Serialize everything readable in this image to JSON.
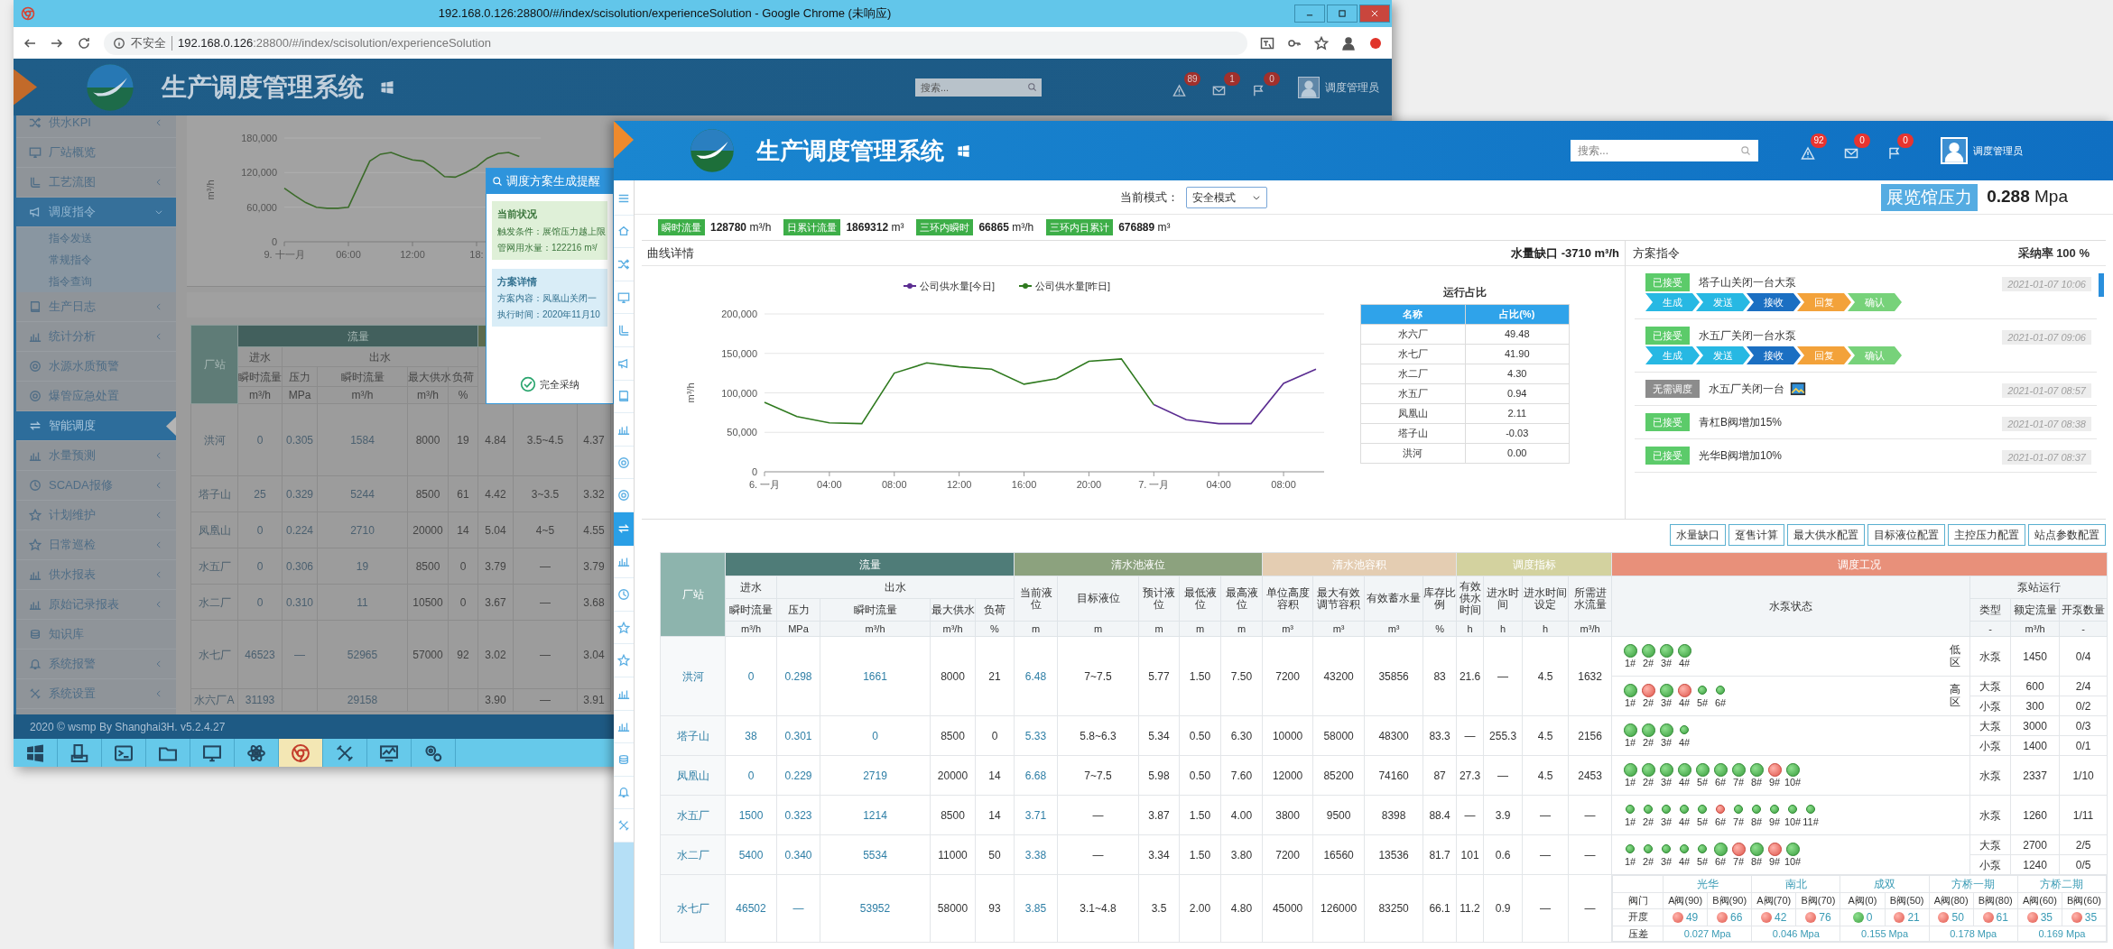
{
  "back_window": {
    "title": "192.168.0.126:28800/#/index/scisolution/experienceSolution - Google Chrome (未响应)",
    "security": "不安全",
    "url_host": "192.168.0.126",
    "url_path": ":28800/#/index/scisolution/experienceSolution",
    "app_title": "生产调度管理系统",
    "search": {
      "placeholder": "搜索..."
    },
    "notifications": [
      {
        "kind": "alert",
        "count": "89"
      },
      {
        "kind": "mail",
        "count": "1"
      },
      {
        "kind": "flag",
        "count": "0"
      }
    ],
    "user": "调度管理员",
    "sidebar": [
      {
        "kind": "shuffle",
        "label": "供水KPI",
        "selected": false,
        "expanded": false
      },
      {
        "kind": "monitor",
        "label": "厂站概览",
        "selected": false
      },
      {
        "kind": "pipe",
        "label": "工艺流图",
        "selected": false,
        "expanded": false
      },
      {
        "kind": "megaphone",
        "label": "调度指令",
        "selected": false,
        "expanded": true,
        "children": [
          {
            "label": "指令发送"
          },
          {
            "label": "常规指令"
          },
          {
            "label": "指令查询"
          }
        ]
      },
      {
        "kind": "book",
        "label": "生产日志",
        "selected": false,
        "expanded": false
      },
      {
        "kind": "chart",
        "label": "统计分析",
        "selected": false,
        "expanded": false
      },
      {
        "kind": "target",
        "label": "水源水质预警",
        "selected": false
      },
      {
        "kind": "target",
        "label": "爆管应急处置",
        "selected": false
      },
      {
        "kind": "swap",
        "label": "智能调度",
        "selected": true
      },
      {
        "kind": "chart",
        "label": "水量预测",
        "selected": false,
        "expanded": false
      },
      {
        "kind": "clock",
        "label": "SCADA报修",
        "selected": false,
        "expanded": false
      },
      {
        "kind": "star",
        "label": "计划维护",
        "selected": false,
        "expanded": false
      },
      {
        "kind": "star",
        "label": "日常巡检",
        "selected": false,
        "expanded": false
      },
      {
        "kind": "chart",
        "label": "供水报表",
        "selected": false,
        "expanded": false
      },
      {
        "kind": "chart",
        "label": "原始记录报表",
        "selected": false,
        "expanded": false
      },
      {
        "kind": "coins",
        "label": "知识库",
        "selected": false
      },
      {
        "kind": "bell",
        "label": "系统报警",
        "selected": false,
        "expanded": false
      },
      {
        "kind": "tools",
        "label": "系统设置",
        "selected": false,
        "expanded": false
      }
    ],
    "chart": {
      "chart_data": {
        "type": "line",
        "ylabel": "m³/h",
        "grid": true,
        "x": [
          "2020-11-09T00:00",
          "2020-11-09T01:00",
          "2020-11-09T02:00",
          "2020-11-09T03:00",
          "2020-11-09T04:00",
          "2020-11-09T05:00",
          "2020-11-09T06:00",
          "2020-11-09T07:00",
          "2020-11-09T08:00",
          "2020-11-09T09:00",
          "2020-11-09T10:00",
          "2020-11-09T11:00",
          "2020-11-09T12:00",
          "2020-11-09T13:00",
          "2020-11-09T14:00",
          "2020-11-09T15:00",
          "2020-11-09T16:00",
          "2020-11-09T17:00",
          "2020-11-09T18:00",
          "2020-11-09T19:00",
          "2020-11-09T20:00",
          "2020-11-09T21:00",
          "2020-11-09T22:00"
        ],
        "xlim": [
          "2020-11-09T00:00",
          "2020-11-10T00:00"
        ],
        "ylim": [
          0,
          180000
        ],
        "xticks": [
          {
            "value": "2020-11-09T00:00",
            "label": "9. 十一月"
          },
          {
            "value": "2020-11-09T06:00",
            "label": "06:00"
          },
          {
            "value": "2020-11-09T12:00",
            "label": "12:00"
          },
          {
            "value": "2020-11-09T18:00",
            "label": "18:"
          }
        ],
        "yticks": [
          {
            "value": 0,
            "label": "0"
          },
          {
            "value": 60000,
            "label": "60,000"
          },
          {
            "value": 120000,
            "label": "120,000"
          },
          {
            "value": 180000,
            "label": "180,000"
          }
        ],
        "series": [
          {
            "color": "#3b6b2a",
            "values": [
              93000,
              80000,
              68000,
              60000,
              58000,
              58000,
              60000,
              100000,
              140000,
              152000,
              155000,
              148000,
              142000,
              140000,
              128000,
              113000,
              112000,
              120000,
              130000,
              145000,
              153000,
              155000,
              148000
            ]
          }
        ]
      }
    },
    "table": {
      "station_header": "厂站",
      "group": "流量",
      "inflow": "进水",
      "outflow": "出水",
      "columns": [
        {
          "label": "瞬时流量",
          "unit": "m³/h"
        },
        {
          "label": "压力",
          "unit": "MPa"
        },
        {
          "label": "瞬时流量",
          "unit": "m³/h"
        },
        {
          "label": "最大供水",
          "unit": "m³/h"
        },
        {
          "label": "负荷",
          "unit": "%"
        }
      ],
      "rows": [
        {
          "station": "洪河",
          "cells": [
            "0",
            "0.305",
            "1584",
            "8000",
            "19",
            "4.84",
            "3.5~4.5",
            "4.37"
          ]
        },
        {
          "station": "塔子山",
          "cells": [
            "25",
            "0.329",
            "5244",
            "8500",
            "61",
            "4.42",
            "3~3.5",
            "3.32"
          ]
        },
        {
          "station": "凤凰山",
          "cells": [
            "0",
            "0.224",
            "2710",
            "20000",
            "14",
            "5.04",
            "4~5",
            "4.55"
          ]
        },
        {
          "station": "水五厂",
          "cells": [
            "0",
            "0.306",
            "19",
            "8500",
            "0",
            "3.79",
            "—",
            "3.79"
          ]
        },
        {
          "station": "水二厂",
          "cells": [
            "0",
            "0.310",
            "11",
            "10500",
            "0",
            "3.67",
            "—",
            "3.68"
          ]
        },
        {
          "station": "水七厂",
          "cells": [
            "46523",
            "—",
            "52965",
            "57000",
            "92",
            "3.02",
            "—",
            "3.04"
          ]
        },
        {
          "station": "水六厂A",
          "cells": [
            "31193",
            null,
            "29158",
            null,
            null,
            "3.90",
            "—",
            "3.91"
          ]
        }
      ]
    },
    "popup": {
      "title": "调度方案生成提醒",
      "sections": [
        {
          "kind": "status",
          "heading": "当前状况",
          "lines": [
            "触发条件：展馆压力越上限",
            "管网用水量：122216 m³/"
          ]
        },
        {
          "kind": "detail",
          "heading": "方案详情",
          "lines": [
            "方案内容：凤凰山关闭一",
            "执行时间：2020年11月10"
          ]
        }
      ],
      "button": "完全采纳"
    },
    "footer": "2020 © wsmp By Shanghai3H. v5.2.4.27",
    "taskbar": [
      {
        "kind": "windows",
        "selected": false
      },
      {
        "kind": "server",
        "selected": false
      },
      {
        "kind": "terminal",
        "selected": false
      },
      {
        "kind": "folder",
        "selected": false
      },
      {
        "kind": "monitor",
        "selected": false
      },
      {
        "kind": "atom",
        "selected": false
      },
      {
        "kind": "browser",
        "selected": true
      },
      {
        "kind": "tools",
        "selected": false
      },
      {
        "kind": "chartmonitor",
        "selected": false
      },
      {
        "kind": "gears",
        "selected": false
      }
    ]
  },
  "front_window": {
    "app_title": "生产调度管理系统",
    "search": {
      "placeholder": "搜索..."
    },
    "notifications": [
      {
        "kind": "alert",
        "count": "92"
      },
      {
        "kind": "mail",
        "count": "0"
      },
      {
        "kind": "flag",
        "count": "0"
      }
    ],
    "user": "调度管理员",
    "icon_bar": [
      {
        "kind": "menu",
        "selected": false
      },
      {
        "kind": "home",
        "selected": false
      },
      {
        "kind": "shuffle",
        "selected": false
      },
      {
        "kind": "monitor",
        "selected": false
      },
      {
        "kind": "pipe",
        "selected": false
      },
      {
        "kind": "megaphone",
        "selected": false
      },
      {
        "kind": "book",
        "selected": false
      },
      {
        "kind": "chart",
        "selected": false
      },
      {
        "kind": "target",
        "selected": false
      },
      {
        "kind": "target",
        "selected": false
      },
      {
        "kind": "swap",
        "selected": true
      },
      {
        "kind": "chart",
        "selected": false
      },
      {
        "kind": "clock",
        "selected": false
      },
      {
        "kind": "star",
        "selected": false
      },
      {
        "kind": "star",
        "selected": false
      },
      {
        "kind": "chart",
        "selected": false
      },
      {
        "kind": "chart",
        "selected": false
      },
      {
        "kind": "coins",
        "selected": false
      },
      {
        "kind": "bell",
        "selected": false
      },
      {
        "kind": "tools",
        "selected": false
      }
    ],
    "mode": {
      "label": "当前模式：",
      "value": "安全模式"
    },
    "pressure": {
      "label": "展览馆压力",
      "value": "**0.288** Mpa"
    },
    "stats": [
      {
        "label": "瞬时流量",
        "value": "**128780** m³/h"
      },
      {
        "label": "日累计流量",
        "value": "**1869312** m³"
      },
      {
        "label": "三环内瞬时",
        "value": "**66865** m³/h"
      },
      {
        "label": "三环内日累计",
        "value": "**676889** m³"
      }
    ],
    "curve_panel": {
      "title": "曲线详情",
      "summary": "水量缺口 -3710 m³/h",
      "chart_data": {
        "type": "line",
        "ylabel": "m³/h",
        "grid": true,
        "legend": "top",
        "x": [
          "2021-01-06T00:00",
          "2021-01-06T02:00",
          "2021-01-06T04:00",
          "2021-01-06T06:00",
          "2021-01-06T08:00",
          "2021-01-06T10:00",
          "2021-01-06T12:00",
          "2021-01-06T14:00",
          "2021-01-06T16:00",
          "2021-01-06T18:00",
          "2021-01-06T20:00",
          "2021-01-06T22:00",
          "2021-01-07T00:00",
          "2021-01-07T02:00",
          "2021-01-07T04:00",
          "2021-01-07T06:00",
          "2021-01-07T08:00",
          "2021-01-07T10:00"
        ],
        "xlim": [
          "2021-01-06T00:00",
          "2021-01-07T10:30"
        ],
        "ylim": [
          0,
          200000
        ],
        "xticks": [
          {
            "value": "2021-01-06T00:00",
            "label": "6. 一月"
          },
          {
            "value": "2021-01-06T04:00",
            "label": "04:00"
          },
          {
            "value": "2021-01-06T08:00",
            "label": "08:00"
          },
          {
            "value": "2021-01-06T12:00",
            "label": "12:00"
          },
          {
            "value": "2021-01-06T16:00",
            "label": "16:00"
          },
          {
            "value": "2021-01-06T20:00",
            "label": "20:00"
          },
          {
            "value": "2021-01-07T00:00",
            "label": "7. 一月"
          },
          {
            "value": "2021-01-07T04:00",
            "label": "04:00"
          },
          {
            "value": "2021-01-07T08:00",
            "label": "08:00"
          }
        ],
        "yticks": [
          {
            "value": 0,
            "label": "0"
          },
          {
            "value": 50000,
            "label": "50,000"
          },
          {
            "value": 100000,
            "label": "100,000"
          },
          {
            "value": 150000,
            "label": "150,000"
          },
          {
            "value": 200000,
            "label": "200,000"
          }
        ],
        "series": [
          {
            "name": "公司供水量[今日]",
            "color": "#5b2d91",
            "values": [
              null,
              null,
              null,
              null,
              null,
              null,
              null,
              null,
              null,
              null,
              null,
              null,
              85000,
              66000,
              61000,
              61000,
              112000,
              130000
            ]
          },
          {
            "name": "公司供水量[昨日]",
            "color": "#2f7a1f",
            "values": [
              88000,
              70000,
              62000,
              61000,
              125000,
              138000,
              133000,
              130000,
              111000,
              118000,
              140000,
              143000,
              85000,
              null,
              null,
              null,
              null,
              null
            ]
          }
        ]
      },
      "ratio_table": {
        "title": "运行占比",
        "columns": [
          "名称",
          "占比(%)"
        ],
        "rows": [
          [
            "水六厂",
            "49.48"
          ],
          [
            "水七厂",
            "41.90"
          ],
          [
            "水二厂",
            "4.30"
          ],
          [
            "水五厂",
            "0.94"
          ],
          [
            "凤凰山",
            "2.11"
          ],
          [
            "塔子山",
            "-0.03"
          ],
          [
            "洪河",
            "0.00"
          ]
        ]
      }
    },
    "plan_panel": {
      "title": "方案指令",
      "summary": "采纳率 100 %",
      "items": [
        {
          "status": "已接受",
          "kind": "accepted",
          "text": "塔子山关闭一台大泵",
          "has_icon": false,
          "time": "2021-01-07 10:06",
          "steps": [
            {
              "label": "生成",
              "color": "#27b8e3"
            },
            {
              "label": "发送",
              "color": "#27b8e3"
            },
            {
              "label": "接收",
              "color": "#1b6fc2"
            },
            {
              "label": "回复",
              "color": "#f3a23a"
            },
            {
              "label": "确认",
              "color": "#77d27a"
            }
          ]
        },
        {
          "status": "已接受",
          "kind": "accepted",
          "text": "水五厂关闭一台水泵",
          "has_icon": false,
          "time": "2021-01-07 09:06",
          "steps": [
            {
              "label": "生成",
              "color": "#27b8e3"
            },
            {
              "label": "发送",
              "color": "#27b8e3"
            },
            {
              "label": "接收",
              "color": "#1b6fc2"
            },
            {
              "label": "回复",
              "color": "#f3a23a"
            },
            {
              "label": "确认",
              "color": "#77d27a"
            }
          ]
        },
        {
          "status": "无需调度",
          "kind": "skipped",
          "text": "水五厂关闭一台",
          "has_icon": true,
          "time": "2021-01-07 08:57"
        },
        {
          "status": "已接受",
          "kind": "accepted",
          "text": "青杠B阀增加15%",
          "has_icon": false,
          "time": "2021-01-07 08:38"
        },
        {
          "status": "已接受",
          "kind": "accepted",
          "text": "光华B阀增加10%",
          "has_icon": false,
          "time": "2021-01-07 08:37"
        }
      ]
    },
    "buttons": [
      "水量缺口",
      "趸售计算",
      "最大供水配置",
      "目标液位配置",
      "主控压力配置",
      "站点参数配置"
    ],
    "table": {
      "station_header": "厂站",
      "groups": [
        {
          "label": "流量",
          "color": "#4f7c78",
          "subgroups": [
            {
              "label": "进水",
              "columns": [
                {
                  "label": "瞬时流量",
                  "unit": "m³/h"
                }
              ]
            },
            {
              "label": "出水",
              "columns": [
                {
                  "label": "压力",
                  "unit": "MPa"
                },
                {
                  "label": "瞬时流量",
                  "unit": "m³/h"
                },
                {
                  "label": "最大供水",
                  "unit": "m³/h"
                },
                {
                  "label": "负荷",
                  "unit": "%"
                }
              ]
            }
          ]
        },
        {
          "label": "清水池液位",
          "color": "#8ca27e",
          "columns": [
            {
              "label": "当前液位",
              "unit": "m"
            },
            {
              "label": "目标液位",
              "unit": "m"
            },
            {
              "label": "预计液位",
              "unit": "m"
            },
            {
              "label": "最低液位",
              "unit": "m"
            },
            {
              "label": "最高液位",
              "unit": "m"
            }
          ]
        },
        {
          "label": "清水池容积",
          "color": "#e4cdb2",
          "columns": [
            {
              "label": "单位高度容积",
              "unit": "m³"
            },
            {
              "label": "最大有效调节容积",
              "unit": "m³"
            },
            {
              "label": "有效蓄水量",
              "unit": "m³"
            },
            {
              "label": "库存比例",
              "unit": "%"
            }
          ]
        },
        {
          "label": "调度指标",
          "color": "#d3d29f",
          "columns": [
            {
              "label": "有效供水时间",
              "unit": "h"
            },
            {
              "label": "进水时间",
              "unit": "h"
            },
            {
              "label": "进水时间设定",
              "unit": "h"
            },
            {
              "label": "所需进水流量",
              "unit": "m³/h"
            }
          ]
        },
        {
          "label": "调度工况",
          "color": "#e8907a",
          "status_header": "水泵状态",
          "subgroups": [
            {
              "label": "泵站运行",
              "columns": [
                {
                  "label": "类型",
                  "unit": "-"
                },
                {
                  "label": "额定流量",
                  "unit": "m³/h"
                },
                {
                  "label": "开泵数量",
                  "unit": "-"
                }
              ]
            }
          ]
        }
      ],
      "rows": [
        {
          "station": "洪河",
          "kind": "pumps",
          "cells": [
            "0",
            "0.298",
            "1661",
            "8000",
            "21",
            "6.48",
            "7~7.5",
            "5.77",
            "1.50",
            "7.50",
            "7200",
            "43200",
            "35856",
            "83",
            "21.6",
            "—",
            "4.5",
            "1632"
          ],
          "pump_groups": [
            {
              "zone": "低区",
              "pumps": [
                {
                  "label": "1#",
                  "kind": "large",
                  "running": false
                },
                {
                  "label": "2#",
                  "kind": "large",
                  "running": false
                },
                {
                  "label": "3#",
                  "kind": "large",
                  "running": false
                },
                {
                  "label": "4#",
                  "kind": "large",
                  "running": false
                }
              ],
              "types": [
                {
                  "type": "水泵",
                  "rated": "1450",
                  "open": "0/4"
                }
              ]
            },
            {
              "zone": "高区",
              "pumps": [
                {
                  "label": "1#",
                  "kind": "large",
                  "running": false
                },
                {
                  "label": "2#",
                  "kind": "large",
                  "running": true
                },
                {
                  "label": "3#",
                  "kind": "large",
                  "running": false
                },
                {
                  "label": "4#",
                  "kind": "large",
                  "running": true
                },
                {
                  "label": "5#",
                  "kind": "small",
                  "running": false
                },
                {
                  "label": "6#",
                  "kind": "small",
                  "running": false
                }
              ],
              "types": [
                {
                  "type": "大泵",
                  "rated": "600",
                  "open": "2/4"
                },
                {
                  "type": "小泵",
                  "rated": "300",
                  "open": "0/2"
                }
              ]
            }
          ]
        },
        {
          "station": "塔子山",
          "kind": "pumps",
          "cells": [
            "38",
            "0.301",
            "0",
            "8500",
            "0",
            "5.33",
            "5.8~6.3",
            "5.34",
            "0.50",
            "6.30",
            "10000",
            "58000",
            "48300",
            "83.3",
            "—",
            "255.3",
            "4.5",
            "2156"
          ],
          "pump_groups": [
            {
              "pumps": [
                {
                  "label": "1#",
                  "kind": "large",
                  "running": false
                },
                {
                  "label": "2#",
                  "kind": "large",
                  "running": false
                },
                {
                  "label": "3#",
                  "kind": "large",
                  "running": false
                },
                {
                  "label": "4#",
                  "kind": "small",
                  "running": false
                }
              ],
              "types": [
                {
                  "type": "大泵",
                  "rated": "3000",
                  "open": "0/3"
                },
                {
                  "type": "小泵",
                  "rated": "1400",
                  "open": "0/1"
                }
              ]
            }
          ]
        },
        {
          "station": "凤凰山",
          "kind": "pumps",
          "cells": [
            "0",
            "0.229",
            "2719",
            "20000",
            "14",
            "6.68",
            "7~7.5",
            "5.98",
            "0.50",
            "7.60",
            "12000",
            "85200",
            "74160",
            "87",
            "27.3",
            "—",
            "4.5",
            "2453"
          ],
          "pump_groups": [
            {
              "pumps": [
                {
                  "label": "1#",
                  "kind": "large",
                  "running": false
                },
                {
                  "label": "2#",
                  "kind": "large",
                  "running": false
                },
                {
                  "label": "3#",
                  "kind": "large",
                  "running": false
                },
                {
                  "label": "4#",
                  "kind": "large",
                  "running": false
                },
                {
                  "label": "5#",
                  "kind": "large",
                  "running": false
                },
                {
                  "label": "6#",
                  "kind": "large",
                  "running": false
                },
                {
                  "label": "7#",
                  "kind": "large",
                  "running": false
                },
                {
                  "label": "8#",
                  "kind": "large",
                  "running": false
                },
                {
                  "label": "9#",
                  "kind": "large",
                  "running": true
                },
                {
                  "label": "10#",
                  "kind": "large",
                  "running": false
                }
              ],
              "types": [
                {
                  "type": "水泵",
                  "rated": "2337",
                  "open": "1/10"
                }
              ]
            }
          ]
        },
        {
          "station": "水五厂",
          "kind": "pumps",
          "cells": [
            "1500",
            "0.323",
            "1214",
            "8500",
            "14",
            "3.71",
            "—",
            "3.87",
            "1.50",
            "4.00",
            "3800",
            "9500",
            "8398",
            "88.4",
            "—",
            "3.9",
            "—",
            "—"
          ],
          "pump_groups": [
            {
              "pumps": [
                {
                  "label": "1#",
                  "kind": "small",
                  "running": false
                },
                {
                  "label": "2#",
                  "kind": "small",
                  "running": false
                },
                {
                  "label": "3#",
                  "kind": "small",
                  "running": false
                },
                {
                  "label": "4#",
                  "kind": "small",
                  "running": false
                },
                {
                  "label": "5#",
                  "kind": "small",
                  "running": false
                },
                {
                  "label": "6#",
                  "kind": "small",
                  "running": true
                },
                {
                  "label": "7#",
                  "kind": "small",
                  "running": false
                },
                {
                  "label": "8#",
                  "kind": "small",
                  "running": false
                },
                {
                  "label": "9#",
                  "kind": "small",
                  "running": false
                },
                {
                  "label": "10#",
                  "kind": "small",
                  "running": false
                },
                {
                  "label": "11#",
                  "kind": "small",
                  "running": false
                }
              ],
              "types": [
                {
                  "type": "水泵",
                  "rated": "1260",
                  "open": "1/11"
                }
              ]
            }
          ]
        },
        {
          "station": "水二厂",
          "kind": "pumps",
          "cells": [
            "5400",
            "0.340",
            "5534",
            "11000",
            "50",
            "3.38",
            "—",
            "3.34",
            "1.50",
            "3.80",
            "7200",
            "16560",
            "13536",
            "81.7",
            "101",
            "0.6",
            "—",
            "—"
          ],
          "pump_groups": [
            {
              "pumps": [
                {
                  "label": "1#",
                  "kind": "small",
                  "running": false
                },
                {
                  "label": "2#",
                  "kind": "small",
                  "running": false
                },
                {
                  "label": "3#",
                  "kind": "small",
                  "running": false
                },
                {
                  "label": "4#",
                  "kind": "small",
                  "running": false
                },
                {
                  "label": "5#",
                  "kind": "small",
                  "running": false
                },
                {
                  "label": "6#",
                  "kind": "large",
                  "running": false
                },
                {
                  "label": "7#",
                  "kind": "large",
                  "running": true
                },
                {
                  "label": "8#",
                  "kind": "large",
                  "running": false
                },
                {
                  "label": "9#",
                  "kind": "large",
                  "running": true
                },
                {
                  "label": "10#",
                  "kind": "large",
                  "running": false
                }
              ],
              "types": [
                {
                  "type": "大泵",
                  "rated": "2700",
                  "open": "2/5"
                },
                {
                  "type": "小泵",
                  "rated": "1240",
                  "open": "0/5"
                }
              ]
            }
          ]
        },
        {
          "station": "水七厂",
          "kind": "valves",
          "cells": [
            "46502",
            "—",
            "53952",
            "58000",
            "93",
            "3.85",
            "3.1~4.8",
            "3.5",
            "2.00",
            "4.80",
            "45000",
            "126000",
            "83250",
            "66.1",
            "11.2",
            "0.9",
            "—",
            "—"
          ],
          "valves": {
            "row_labels": [
              "阀门",
              "开度",
              "压差"
            ],
            "groups": [
              {
                "name": "光华",
                "pressure": "0.027 Mpa",
                "valves": [
                  {
                    "label": "A阀(90)",
                    "opening": "49",
                    "open": true
                  },
                  {
                    "label": "B阀(90)",
                    "opening": "66",
                    "open": true
                  }
                ]
              },
              {
                "name": "南北",
                "pressure": "0.046 Mpa",
                "valves": [
                  {
                    "label": "A阀(70)",
                    "opening": "42",
                    "open": true
                  },
                  {
                    "label": "B阀(70)",
                    "opening": "76",
                    "open": true
                  }
                ]
              },
              {
                "name": "成双",
                "pressure": "0.155 Mpa",
                "valves": [
                  {
                    "label": "A阀(0)",
                    "opening": "0",
                    "open": false
                  },
                  {
                    "label": "B阀(50)",
                    "opening": "21",
                    "open": true
                  }
                ]
              },
              {
                "name": "方桥一期",
                "pressure": "0.178 Mpa",
                "valves": [
                  {
                    "label": "A阀(80)",
                    "opening": "50",
                    "open": true
                  },
                  {
                    "label": "B阀(80)",
                    "opening": "61",
                    "open": true
                  }
                ]
              },
              {
                "name": "方桥二期",
                "pressure": "0.169 Mpa",
                "valves": [
                  {
                    "label": "A阀(60)",
                    "opening": "35",
                    "open": true
                  },
                  {
                    "label": "B阀(60)",
                    "opening": "35",
                    "open": true
                  }
                ]
              }
            ]
          }
        }
      ]
    }
  }
}
